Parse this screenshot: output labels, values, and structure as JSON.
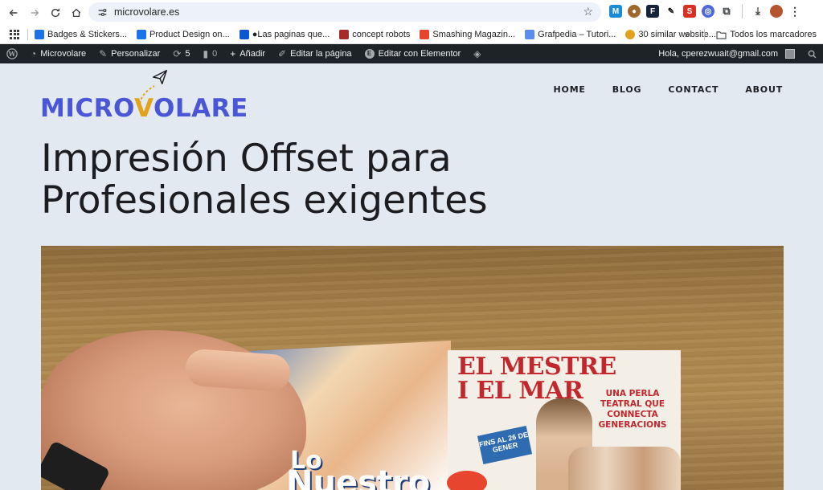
{
  "browser": {
    "url": "microvolare.es"
  },
  "bookmarks": [
    {
      "label": "Badges & Stickers...",
      "color": "#1a73e8"
    },
    {
      "label": "Product Design on...",
      "color": "#1a73e8"
    },
    {
      "label": "●Las paginas que...",
      "color": "#0b57d0"
    },
    {
      "label": "concept robots",
      "color": "#a52a2a"
    },
    {
      "label": "Smashing Magazin...",
      "color": "#e8452f"
    },
    {
      "label": "Grafpedia – Tutori...",
      "color": "#5b8def"
    },
    {
      "label": "30 similar website...",
      "color": "#e3a21b"
    }
  ],
  "bookmarks_folder": "Todos los marcadores",
  "wp_admin": {
    "site_name": "Microvolare",
    "customize": "Personalizar",
    "updates_count": "5",
    "comments_count": "0",
    "add_new": "Añadir",
    "edit_page": "Editar la página",
    "edit_elementor": "Editar con Elementor",
    "greeting": "Hola, cperezwuait@gmail.com"
  },
  "site": {
    "logo_text_before": "MICRO",
    "logo_text_v": "V",
    "logo_text_after": "OLARE",
    "nav": [
      "HOME",
      "BLOG",
      "CONTACT",
      "ABOUT"
    ]
  },
  "hero": {
    "title_line1": "Impresión Offset para",
    "title_line2": "Profesionales exigentes"
  },
  "featured_image": {
    "poster_title_line1": "EL MESTRE",
    "poster_title_line2": "I EL MAR",
    "poster_tagline": "UNA PERLA TEATRAL QUE CONNECTA GENERACIONS",
    "poster_date": "FINS AL 26 DE GENER",
    "magazine_word1": "Lo",
    "magazine_word2": "Nuestro"
  },
  "colors": {
    "brand_blue": "#4a56d6",
    "brand_yellow": "#e3a21b",
    "admin_bar": "#1d2327",
    "page_bg": "#e3e9f1"
  }
}
